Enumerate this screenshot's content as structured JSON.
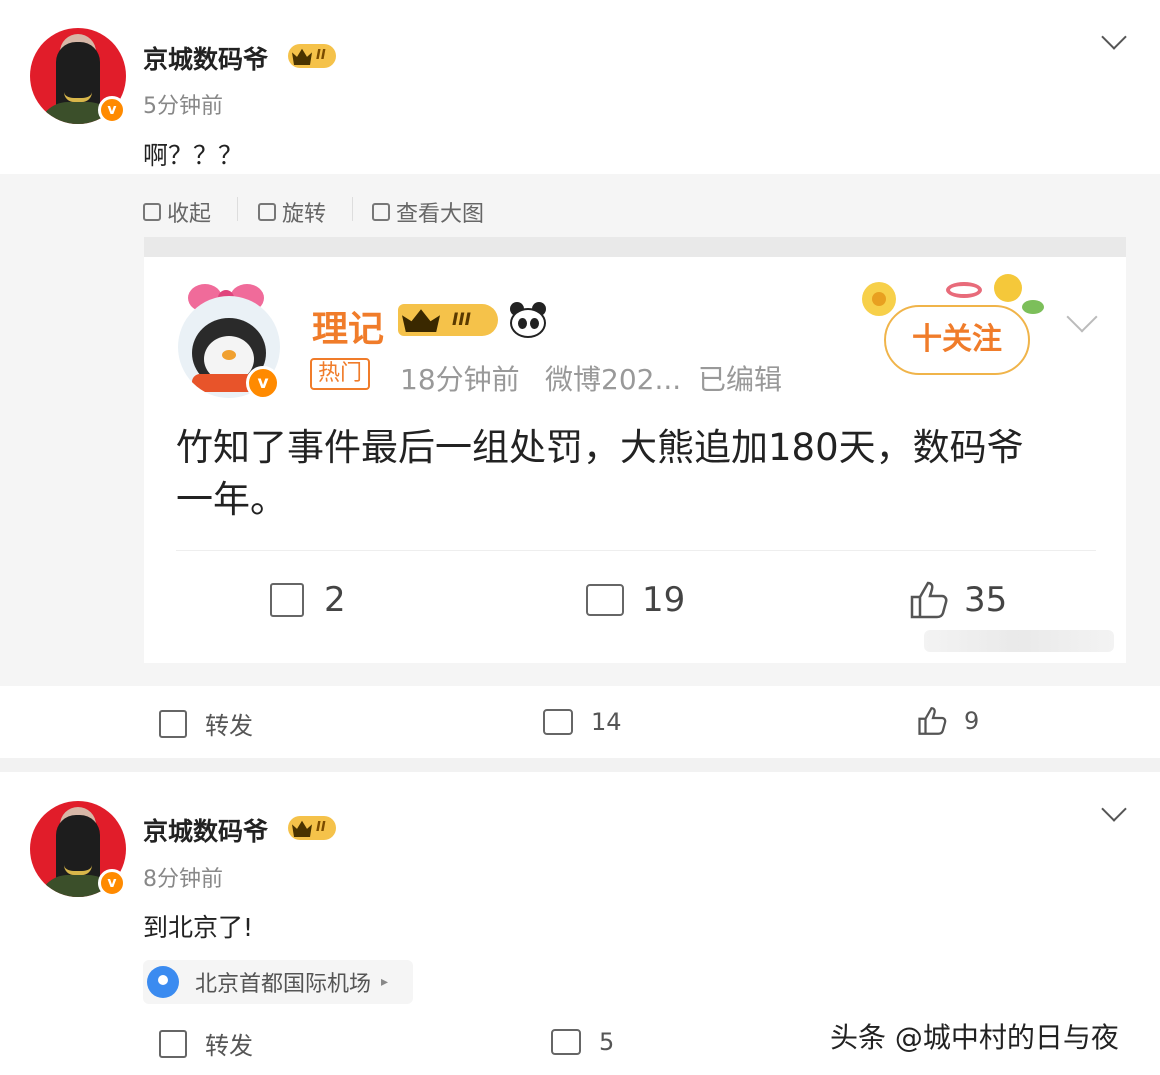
{
  "post1": {
    "username": "京城数码爷",
    "level": "II",
    "time": "5分钟前",
    "text": "啊？？？",
    "image_toolbar": {
      "collapse": "收起",
      "rotate": "旋转",
      "view_large": "查看大图"
    },
    "actions": {
      "repost": "转发",
      "comments": "14",
      "likes": "9"
    }
  },
  "embedded": {
    "username": "理记",
    "level": "III",
    "tag": "热门",
    "time": "18分钟前",
    "source": "微博202...",
    "edited": "已编辑",
    "follow": "十关注",
    "text_line1": "竹知了事件最后一组处罚，大熊追加180天，数码爷",
    "text_line2": "一年。",
    "actions": {
      "reposts": "2",
      "comments": "19",
      "likes": "35"
    }
  },
  "post2": {
    "username": "京城数码爷",
    "level": "II",
    "time": "8分钟前",
    "text": "到北京了!",
    "location": "北京首都国际机场",
    "actions": {
      "repost": "转发",
      "comments": "5"
    }
  },
  "watermark": "头条 @城中村的日与夜",
  "colors": {
    "accent": "#f07c2a",
    "verified": "#ff8a00",
    "crown": "#f5c24a",
    "pin": "#3b8bf0"
  }
}
